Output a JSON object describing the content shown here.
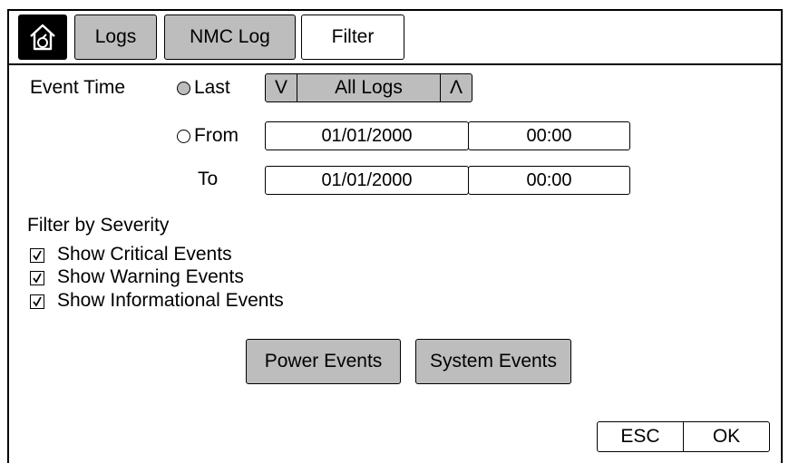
{
  "tabs": {
    "home_icon": "home-icon",
    "items": [
      {
        "label": "Logs",
        "active": false
      },
      {
        "label": "NMC Log",
        "active": false
      },
      {
        "label": "Filter",
        "active": true
      }
    ]
  },
  "event_time": {
    "label": "Event Time",
    "last": {
      "label": "Last",
      "selected": false,
      "value": "All Logs",
      "prev_label": "V",
      "next_label": "Λ"
    },
    "from": {
      "label": "From",
      "selected": false,
      "date": "01/01/2000",
      "time": "00:00"
    },
    "to": {
      "label": "To",
      "date": "01/01/2000",
      "time": "00:00"
    }
  },
  "severity": {
    "heading": "Filter by Severity",
    "items": [
      {
        "label": "Show Critical Events",
        "checked": true
      },
      {
        "label": "Show Warning Events",
        "checked": true
      },
      {
        "label": "Show Informational Events",
        "checked": true
      }
    ]
  },
  "buttons": {
    "power_events": "Power Events",
    "system_events": "System Events",
    "esc": "ESC",
    "ok": "OK"
  },
  "colors": {
    "inactive_fill": "#bdbdbd",
    "border": "#000000"
  }
}
